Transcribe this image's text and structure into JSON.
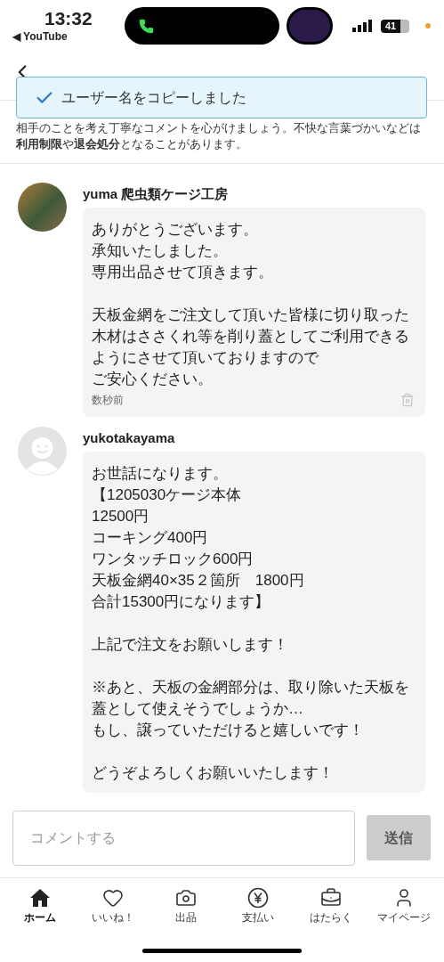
{
  "status_bar": {
    "time": "13:32",
    "back_app": "◀ YouTube",
    "battery": "41"
  },
  "toast": {
    "text": "ユーザー名をコピーしました"
  },
  "notice": "相手のことを考え丁寧なコメントを心がけましょう。不快な言葉づかいなどは**利用制限**や**退会処分**となることがあります。",
  "comments": [
    {
      "kind": "photo",
      "user": "yuma 爬虫類ケージ工房",
      "paragraphs": [
        [
          "ありがとうございます。",
          "承知いたしました。",
          "専用出品させて頂きます。"
        ],
        [
          "天板金網をご注文して頂いた皆様に切り取った",
          "木材はささくれ等を削り蓋としてご利用できる",
          "ようにさせて頂いておりますので",
          "ご安心ください。"
        ]
      ],
      "time": "数秒前",
      "deletable": true
    },
    {
      "kind": "default",
      "user": "yukotakayama",
      "paragraphs": [
        [
          "お世話になります。",
          "【1205030ケージ本体",
          "12500円",
          "コーキング400円",
          "ワンタッチロック600円",
          "天板金網40×35２箇所　1800円",
          "合計15300円になります】"
        ],
        [
          "上記で注文をお願いします！"
        ],
        [
          "※あと、天板の金網部分は、取り除いた天板を",
          "蓋として使えそうでしょうか…",
          "もし、譲っていただけると嬉しいです！"
        ],
        [
          "どうぞよろしくお願いいたします！"
        ]
      ]
    }
  ],
  "composer": {
    "placeholder": "コメントする",
    "send": "送信",
    "disabled": true
  },
  "tab_bar": [
    {
      "kind": "home",
      "label": "ホーム",
      "selected": true
    },
    {
      "kind": "heart",
      "label": "いいね！",
      "selected": false
    },
    {
      "kind": "camera",
      "label": "出品",
      "selected": false
    },
    {
      "kind": "yen",
      "label": "支払い",
      "selected": false
    },
    {
      "kind": "work",
      "label": "はたらく",
      "selected": false
    },
    {
      "kind": "user",
      "label": "マイページ",
      "selected": false
    }
  ]
}
